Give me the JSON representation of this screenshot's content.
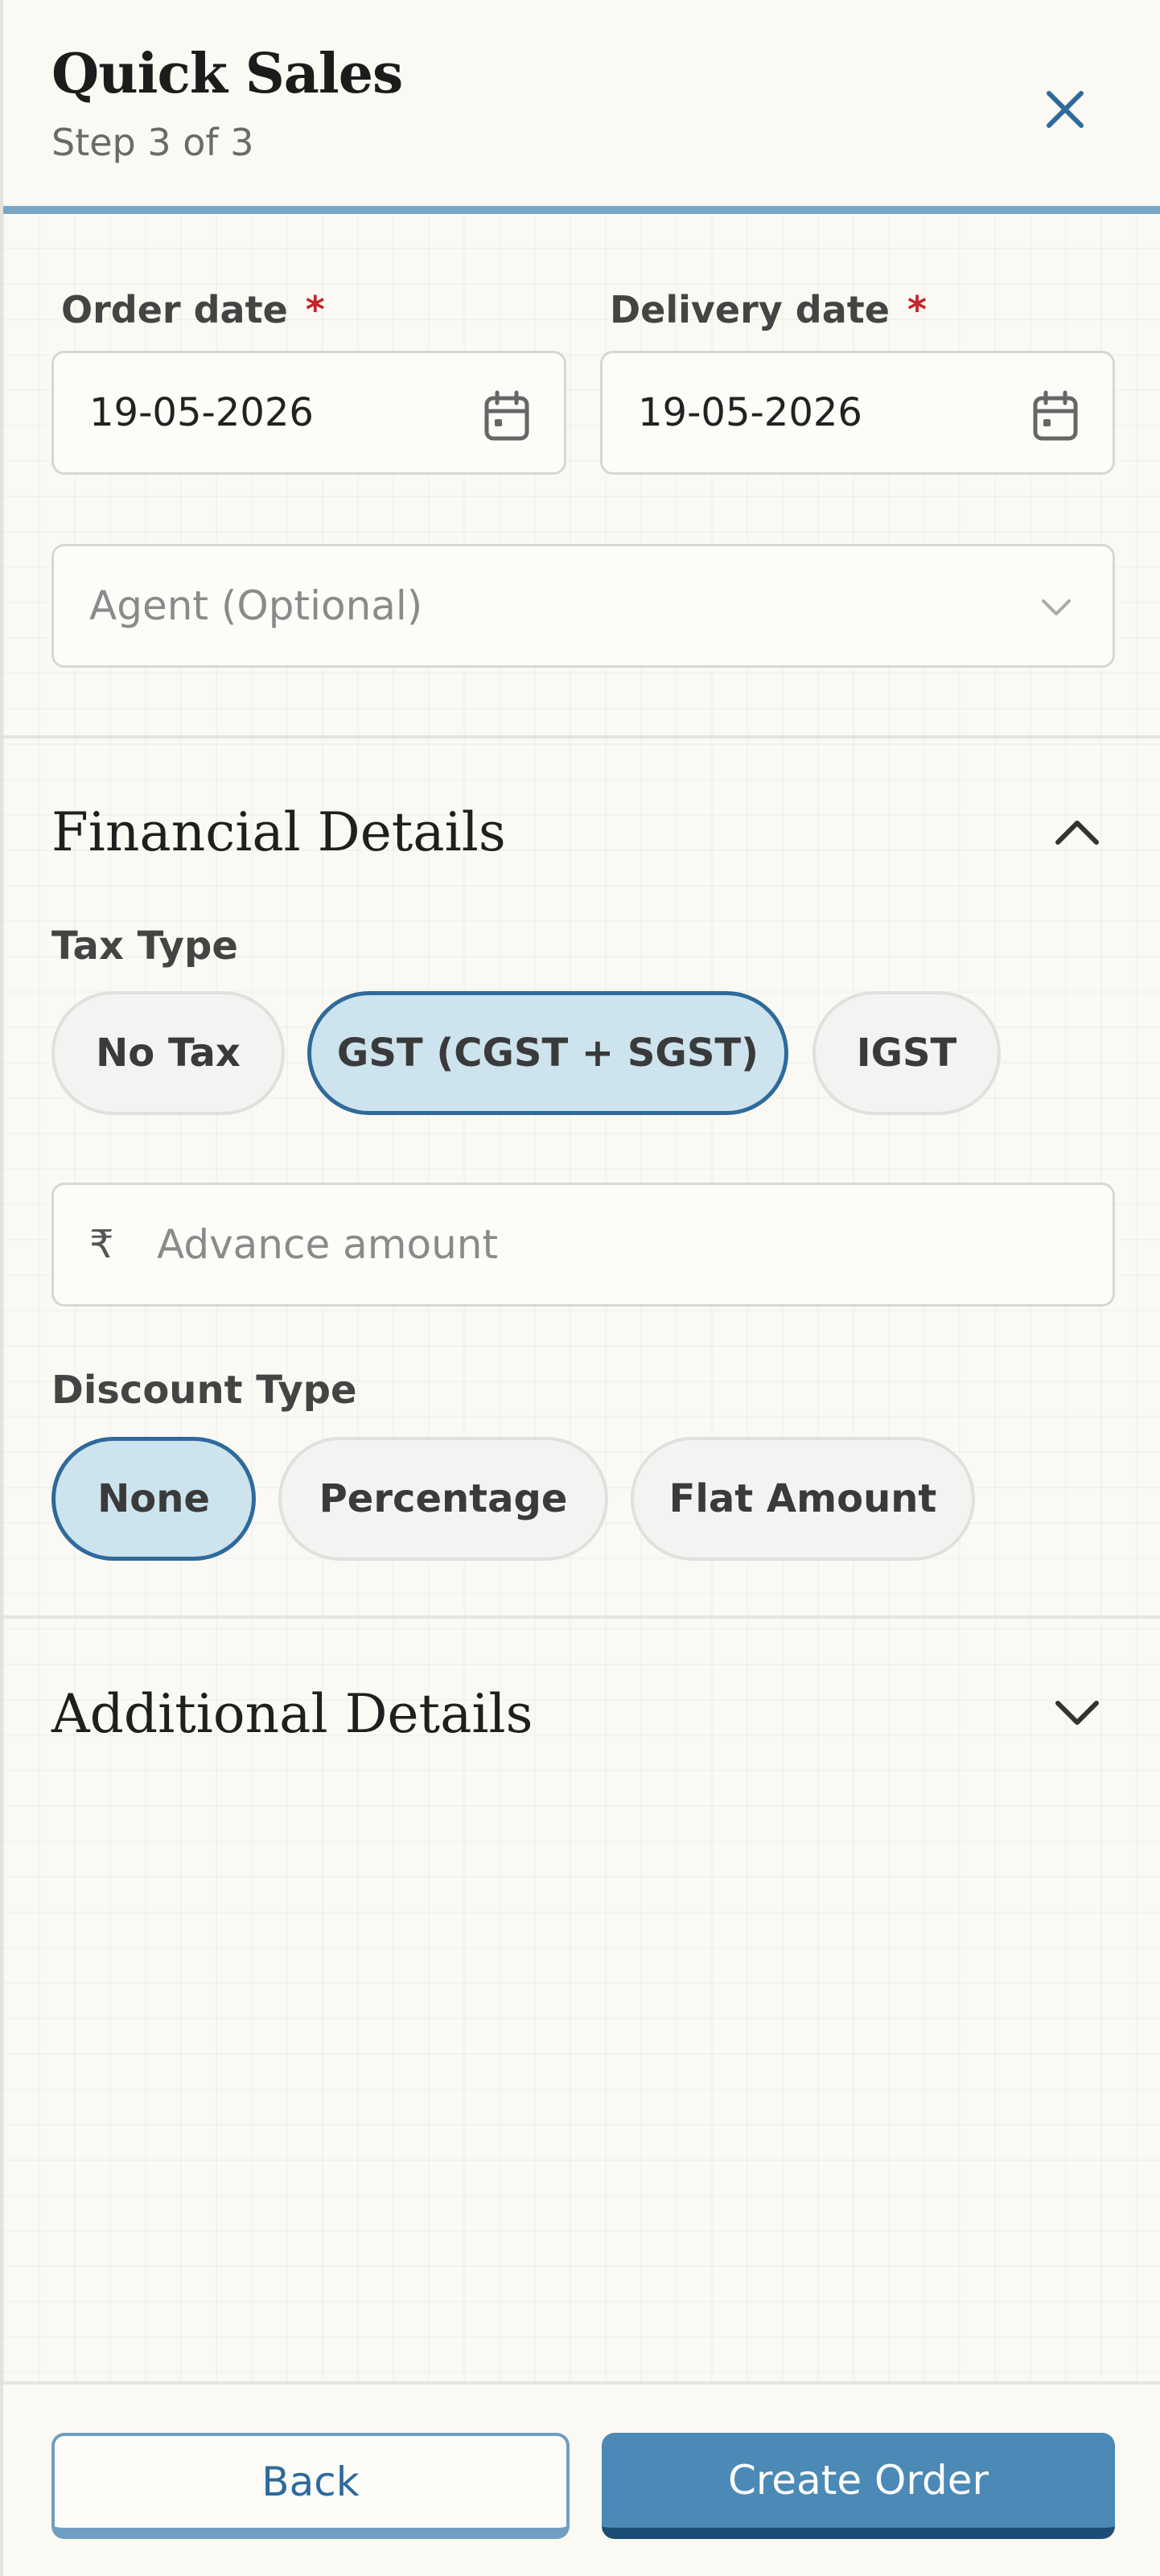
{
  "header": {
    "title": "Quick Sales",
    "step": "Step 3 of 3",
    "close_icon": "close-icon"
  },
  "dates": {
    "order_label": "Order date",
    "order_value": "19-05-2026",
    "delivery_label": "Delivery date",
    "delivery_value": "19-05-2026",
    "required_mark": "*",
    "calendar_icon": "calendar-icon"
  },
  "agent": {
    "placeholder": "Agent (Optional)",
    "chevron_icon": "chevron-down-icon"
  },
  "financial": {
    "title": "Financial Details",
    "expanded": true,
    "tax_type_label": "Tax Type",
    "tax_options": [
      "No Tax",
      "GST (CGST + SGST)",
      "IGST"
    ],
    "tax_selected": "GST (CGST + SGST)",
    "currency_symbol": "₹",
    "advance_placeholder": "Advance amount",
    "discount_type_label": "Discount Type",
    "discount_options": [
      "None",
      "Percentage",
      "Flat Amount"
    ],
    "discount_selected": "None"
  },
  "additional": {
    "title": "Additional Details",
    "expanded": false
  },
  "footer": {
    "back_label": "Back",
    "create_label": "Create Order"
  },
  "colors": {
    "accent": "#2e6a9c",
    "primary_button": "#4b89b6",
    "selected_chip": "#cde3ee",
    "required": "#c0262d",
    "header_bar": "#7aa6c6"
  }
}
